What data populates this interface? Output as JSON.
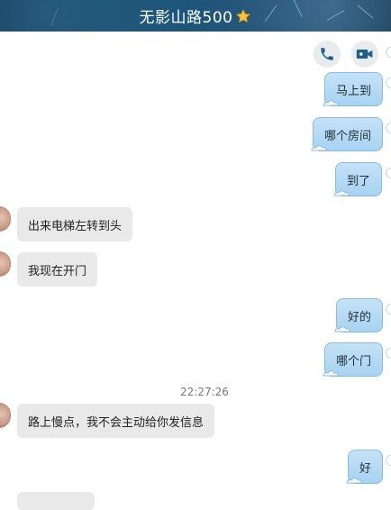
{
  "header": {
    "title": "无影山路500",
    "star_icon": "star-icon"
  },
  "toolbar": {
    "phone_icon": "phone-icon",
    "video_icon": "video-camera-icon",
    "accent": "#1e5f86"
  },
  "messages": [
    {
      "side": "out",
      "text": "马上到"
    },
    {
      "side": "out",
      "text": "哪个房间"
    },
    {
      "side": "out",
      "text": "到了"
    },
    {
      "side": "in",
      "text": "出来电梯左转到头"
    },
    {
      "side": "in",
      "text": "我现在开门"
    },
    {
      "side": "out",
      "text": "好的"
    },
    {
      "side": "out",
      "text": "哪个门"
    },
    {
      "side": "in",
      "text": "路上慢点，我不会主动给你发信息"
    },
    {
      "side": "out",
      "text": "好"
    }
  ],
  "timestamp": "22:27:26"
}
